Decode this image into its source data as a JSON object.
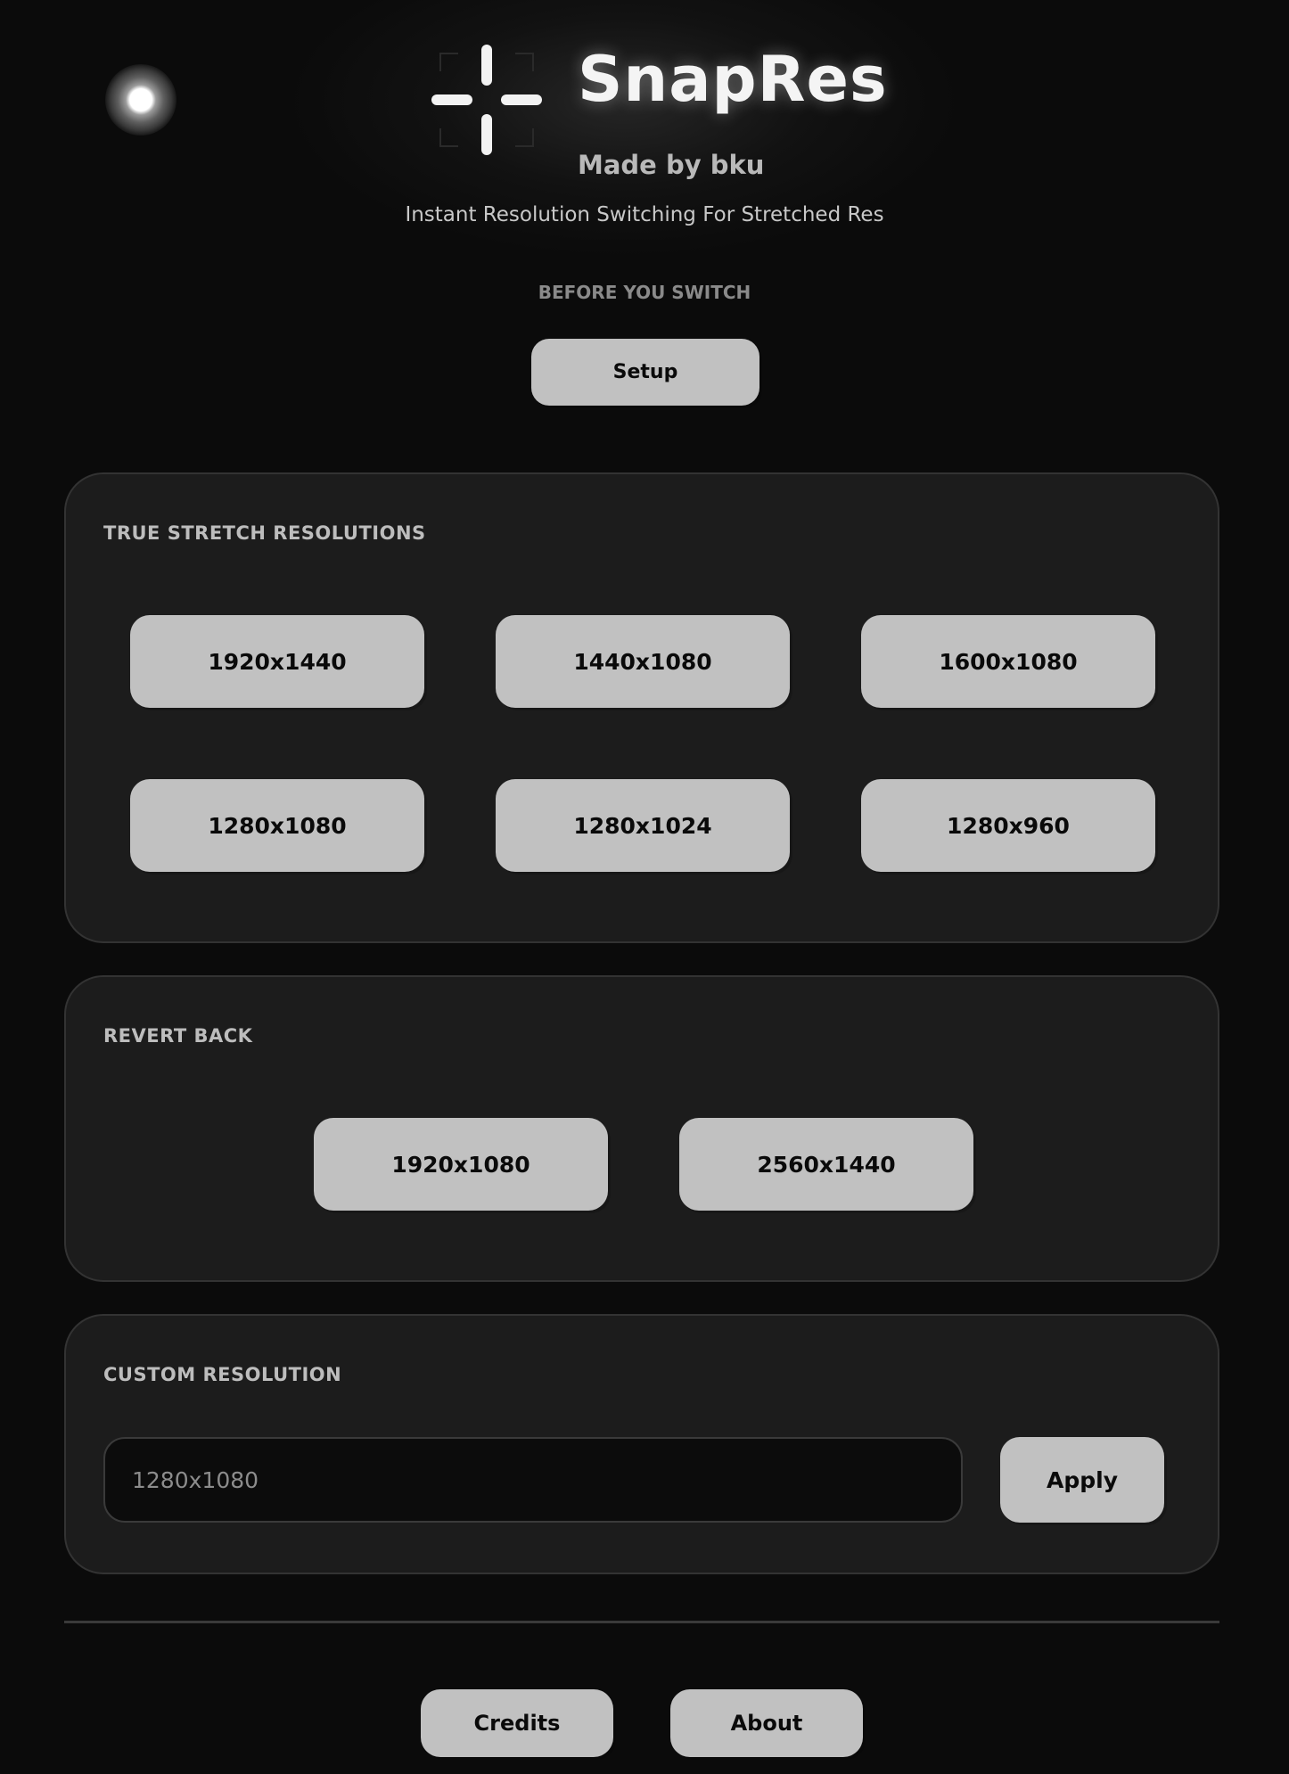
{
  "header": {
    "title": "SnapRes",
    "author": "Made by bku",
    "tagline": "Instant Resolution Switching For Stretched Res",
    "logo_icon": "crosshair-icon",
    "status_icon": "status-dot-icon"
  },
  "setup": {
    "hint": "BEFORE YOU SWITCH",
    "button_label": "Setup"
  },
  "stretch_section": {
    "title": "TRUE STRETCH RESOLUTIONS",
    "resolutions": [
      "1920x1440",
      "1440x1080",
      "1600x1080",
      "1280x1080",
      "1280x1024",
      "1280x960"
    ]
  },
  "revert_section": {
    "title": "REVERT BACK",
    "resolutions": [
      "1920x1080",
      "2560x1440"
    ]
  },
  "custom_section": {
    "title": "CUSTOM RESOLUTION",
    "input_placeholder": "1280x1080",
    "apply_label": "Apply"
  },
  "footer": {
    "credits_label": "Credits",
    "about_label": "About"
  },
  "colors": {
    "background": "#0b0b0b",
    "panel": "#1c1c1c",
    "button": "#c1c1c1",
    "button_text": "#0a0a0a"
  }
}
